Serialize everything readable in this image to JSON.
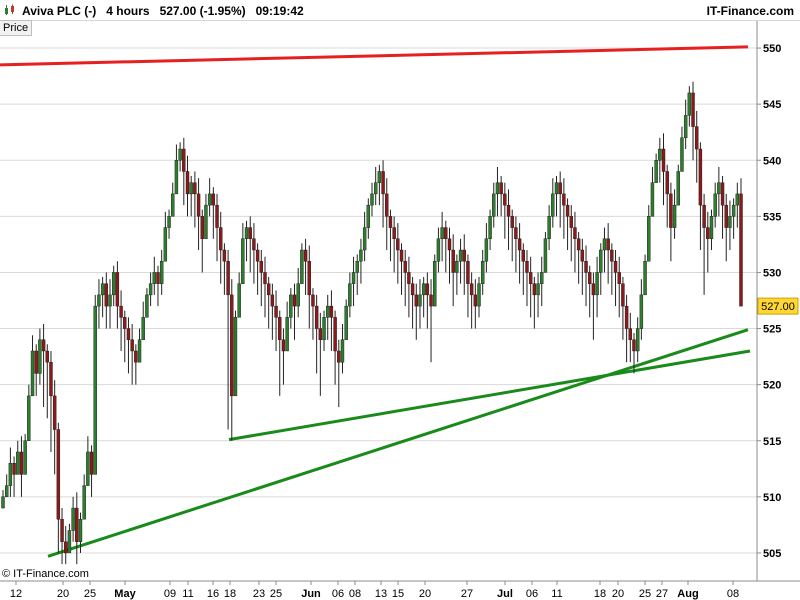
{
  "header": {
    "title": "Aviva PLC (-)   4 hours   527.00 (-1.95%)   09:19:42",
    "brand": "IT-Finance.com",
    "logo_icon": "candlestick-logo-icon"
  },
  "price_tab": "Price",
  "credit": "© IT-Finance.com",
  "colors": {
    "up": "#2e7d2e",
    "down": "#8b1a1a",
    "resistance": "#e62020",
    "support": "#1a8a1a",
    "grid": "#d9d9d9",
    "last_price_bg": "#ffd633"
  },
  "chart_data": {
    "type": "candlestick",
    "ylim": [
      502.5,
      552.5
    ],
    "y_ticks": [
      "505",
      "510",
      "515",
      "520",
      "525",
      "530",
      "535",
      "540",
      "545",
      "550"
    ],
    "x_ticks": [
      "12",
      "20",
      "25",
      "May",
      "09",
      "11",
      "16",
      "18",
      "23",
      "25",
      "Jun",
      "06",
      "08",
      "13",
      "15",
      "20",
      "27",
      "Jul",
      "06",
      "11",
      "18",
      "20",
      "25",
      "27",
      "Aug",
      "08"
    ],
    "last_price": "527.00",
    "trendlines": [
      {
        "name": "resistance",
        "from": 548.5,
        "to": 550.1
      },
      {
        "name": "support-1",
        "from": 504.7,
        "to": 524.9
      },
      {
        "name": "support-2",
        "from": 515.1,
        "to": 523.0
      }
    ],
    "closes": [
      510,
      511,
      513,
      512,
      514,
      512,
      515,
      519,
      523,
      521,
      524,
      523,
      522,
      519,
      516,
      508,
      506,
      505,
      507,
      509,
      506,
      508,
      511,
      514,
      512,
      527,
      528,
      529,
      527,
      528,
      530,
      527,
      526,
      525,
      524,
      523,
      522,
      524,
      526,
      528,
      529,
      530,
      529,
      531,
      534,
      535,
      537,
      540,
      541,
      539,
      537,
      538,
      537,
      535,
      533,
      536,
      537,
      536,
      534,
      532,
      531,
      528,
      519,
      526,
      529,
      533,
      534,
      533,
      532,
      531,
      530,
      529,
      528,
      527,
      526,
      524,
      523,
      526,
      528,
      527,
      529,
      532,
      531,
      528,
      527,
      525,
      524,
      526,
      527,
      526,
      523,
      522,
      524,
      527,
      529,
      530,
      531,
      532,
      534,
      536,
      537,
      538,
      539,
      537,
      535,
      534,
      533,
      532,
      531,
      530,
      529,
      528,
      527,
      528,
      529,
      528,
      527,
      531,
      533,
      534,
      533,
      532,
      530,
      531,
      532,
      531,
      529,
      528,
      527,
      529,
      531,
      533,
      535,
      537,
      538,
      537,
      536,
      535,
      534,
      533,
      532,
      531,
      530,
      529,
      528,
      529,
      530,
      533,
      535,
      537,
      538,
      537,
      536,
      535,
      534,
      533,
      532,
      531,
      530,
      529,
      528,
      530,
      532,
      533,
      532,
      531,
      530,
      529,
      527,
      525,
      524,
      523,
      525,
      528,
      531,
      535,
      538,
      540,
      541,
      539,
      537,
      534,
      536,
      539,
      542,
      544,
      546,
      543,
      541,
      536,
      534,
      533,
      535,
      537,
      538,
      536,
      534,
      535,
      536,
      537,
      527
    ],
    "lows": [
      509,
      510,
      510,
      510,
      512,
      510,
      512,
      515,
      519,
      519,
      520,
      518,
      517,
      514,
      512,
      505,
      504,
      504,
      505,
      506,
      504,
      505,
      508,
      511,
      510,
      521,
      525,
      526,
      525,
      525,
      527,
      525,
      523,
      522,
      521,
      520,
      520,
      522,
      524,
      526,
      527,
      528,
      527,
      528,
      531,
      533,
      535,
      538,
      539,
      536,
      535,
      535,
      534,
      532,
      530,
      533,
      535,
      533,
      531,
      529,
      528,
      516,
      515,
      522,
      526,
      530,
      531,
      530,
      529,
      528,
      527,
      526,
      525,
      524,
      523,
      519,
      520,
      523,
      525,
      524,
      526,
      529,
      528,
      525,
      524,
      521,
      519,
      523,
      524,
      523,
      520,
      518,
      521,
      524,
      526,
      527,
      528,
      529,
      531,
      533,
      535,
      536,
      536,
      534,
      532,
      531,
      530,
      529,
      528,
      527,
      526,
      525,
      524,
      525,
      526,
      525,
      522,
      528,
      530,
      531,
      530,
      529,
      527,
      528,
      529,
      528,
      526,
      525,
      525,
      526,
      528,
      530,
      532,
      534,
      535,
      535,
      533,
      532,
      531,
      530,
      529,
      528,
      527,
      526,
      525,
      526,
      527,
      530,
      532,
      534,
      535,
      534,
      533,
      532,
      531,
      530,
      529,
      528,
      527,
      526,
      524,
      526,
      528,
      530,
      529,
      528,
      527,
      526,
      524,
      522,
      522,
      521,
      522,
      524,
      528,
      531,
      535,
      538,
      538,
      536,
      534,
      531,
      533,
      536,
      539,
      541,
      543,
      540,
      538,
      532,
      528,
      530,
      532,
      534,
      535,
      533,
      531,
      532,
      533,
      534,
      527
    ]
  }
}
